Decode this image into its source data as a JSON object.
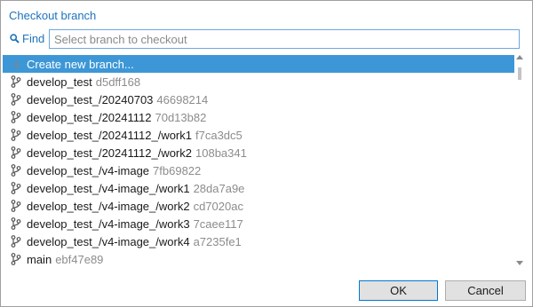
{
  "dialog": {
    "title": "Checkout branch"
  },
  "find": {
    "label": "Find",
    "icon": "search-icon",
    "placeholder": "Select branch to checkout",
    "value": ""
  },
  "list": {
    "create_item": {
      "label": "Create new branch...",
      "icon": "plus-icon",
      "selected": true
    },
    "branches": [
      {
        "name": "develop_test",
        "hash": "d5dff168"
      },
      {
        "name": "develop_test_/20240703",
        "hash": "46698214"
      },
      {
        "name": "develop_test_/20241112",
        "hash": "70d13b82"
      },
      {
        "name": "develop_test_/20241112_/work1",
        "hash": "f7ca3dc5"
      },
      {
        "name": "develop_test_/20241112_/work2",
        "hash": "108ba341"
      },
      {
        "name": "develop_test_/v4-image",
        "hash": "7fb69822"
      },
      {
        "name": "develop_test_/v4-image_/work1",
        "hash": "28da7a9e"
      },
      {
        "name": "develop_test_/v4-image_/work2",
        "hash": "cd7020ac"
      },
      {
        "name": "develop_test_/v4-image_/work3",
        "hash": "7caee117"
      },
      {
        "name": "develop_test_/v4-image_/work4",
        "hash": "a7235fe1"
      },
      {
        "name": "main",
        "hash": "ebf47e89"
      }
    ],
    "branch_icon": "git-branch-icon"
  },
  "buttons": {
    "ok": "OK",
    "cancel": "Cancel"
  },
  "colors": {
    "accent": "#1e73be",
    "selection": "#3d97d6",
    "hash": "#8c8c8c"
  }
}
